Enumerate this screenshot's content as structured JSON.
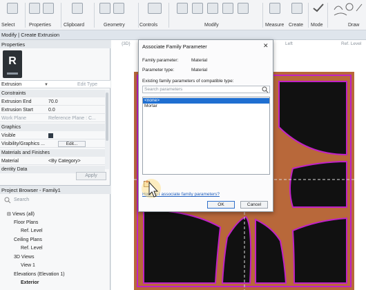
{
  "ribbon": {
    "groups": [
      "Select",
      "Properties",
      "Clipboard",
      "Geometry",
      "Controls",
      "Modify",
      "Measure",
      "Create",
      "Mode",
      "Draw"
    ]
  },
  "context_bar": {
    "text": "Modify | Create Extrusion"
  },
  "properties": {
    "title": "Properties",
    "type": "Extrusion",
    "edit_type": "Edit Type",
    "sections": {
      "constraints": "Constraints",
      "graphics": "Graphics",
      "materials": "Materials and Finishes",
      "identity": "dentity Data"
    },
    "rows": {
      "extrusion_end": {
        "label": "Extrusion End",
        "value": "70.0"
      },
      "extrusion_start": {
        "label": "Extrusion Start",
        "value": "0.0"
      },
      "work_plane": {
        "label": "Work Plane",
        "value": "Reference Plane : C..."
      },
      "visible": {
        "label": "Visible"
      },
      "vis_graphics": {
        "label": "Visibility/Graphics ...",
        "button": "Edit..."
      },
      "material": {
        "label": "Material",
        "value": "<By Category>"
      }
    },
    "apply": "Apply"
  },
  "browser": {
    "title": "Project Browser - Family1",
    "search_placeholder": "Search",
    "items": [
      "Views (all)",
      "Floor Plans",
      "Ref. Level",
      "Ceiling Plans",
      "Ref. Level",
      "3D Views",
      "View 1",
      "Elevations (Elevation 1)",
      "Exterior"
    ]
  },
  "canvas": {
    "tabs": [
      "{3D}",
      "Left",
      "Ref. Level"
    ]
  },
  "dialog": {
    "title": "Associate Family Parameter",
    "close": "✕",
    "family_parameter_label": "Family parameter:",
    "family_parameter_value": "Material",
    "parameter_type_label": "Parameter type:",
    "parameter_type_value": "Material",
    "existing_label": "Existing family parameters of compatible type:",
    "search_placeholder": "Search parameters",
    "list": [
      "<none>",
      "Mortar"
    ],
    "help_link": "How do I associate family parameters?",
    "ok": "OK",
    "cancel": "Cancel"
  },
  "colors": {
    "tile": "#b8683a",
    "outline": "#c021c7",
    "selection": "#1f6fd1"
  }
}
